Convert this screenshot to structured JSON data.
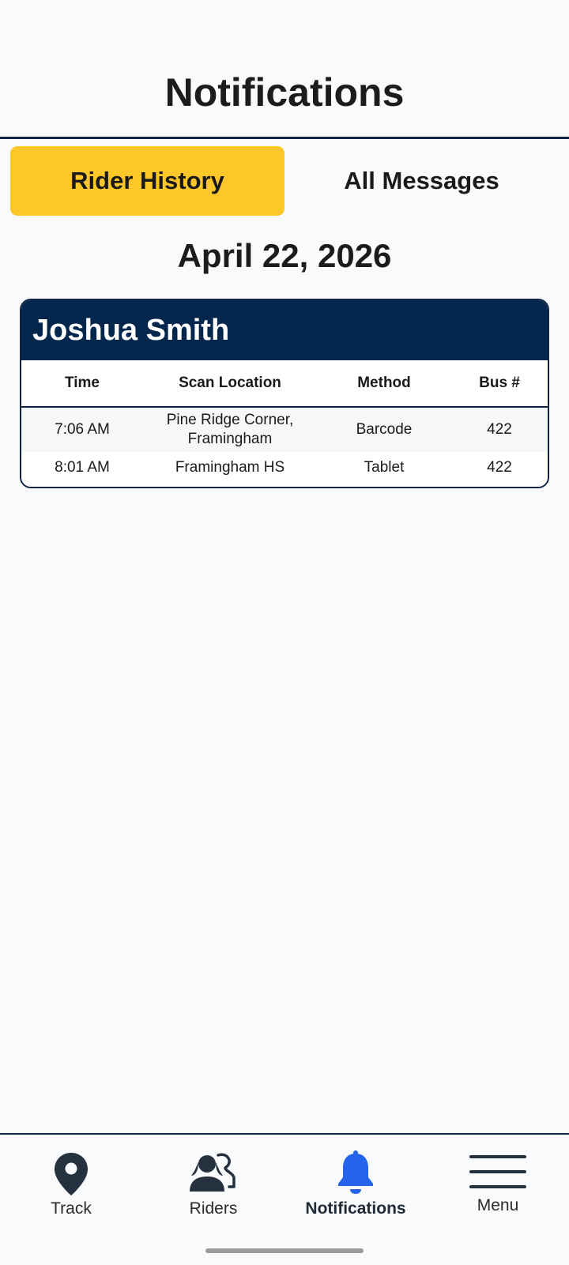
{
  "header": {
    "title": "Notifications"
  },
  "tabs": [
    {
      "label": "Rider History",
      "active": true
    },
    {
      "label": "All Messages",
      "active": false
    }
  ],
  "date": "April 22, 2026",
  "rider_card": {
    "name": "Joshua Smith",
    "columns": [
      "Time",
      "Scan Location",
      "Method",
      "Bus #"
    ],
    "rows": [
      {
        "time": "7:06 AM",
        "location": "Pine Ridge Corner, Framingham",
        "method": "Barcode",
        "bus": "422"
      },
      {
        "time": "8:01 AM",
        "location": "Framingham HS",
        "method": "Tablet",
        "bus": "422"
      }
    ]
  },
  "bottom_nav": {
    "items": [
      {
        "label": "Track",
        "icon": "map-pin-icon",
        "active": false
      },
      {
        "label": "Riders",
        "icon": "riders-icon",
        "active": false
      },
      {
        "label": "Notifications",
        "icon": "bell-icon",
        "active": true
      },
      {
        "label": "Menu",
        "icon": "hamburger-menu-icon",
        "active": false
      }
    ]
  },
  "colors": {
    "accent_tab": "#fdc72a",
    "card_header": "#02264c",
    "nav_active_icon": "#2563eb",
    "dark_icon": "#263140",
    "border": "#0f2544"
  }
}
